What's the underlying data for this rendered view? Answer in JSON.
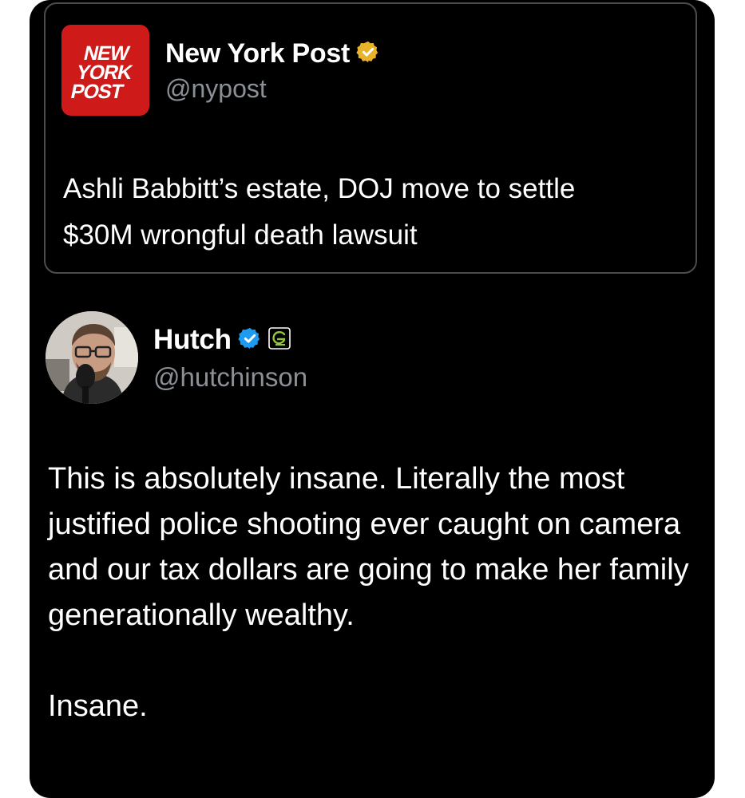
{
  "quoted_post": {
    "author_name": "New York Post",
    "handle": "@nypost",
    "logo": {
      "lines": [
        "NEW",
        "YORK",
        "POST"
      ],
      "icon": "nypost-logo",
      "color": "#cf1a1a"
    },
    "badge": {
      "icon": "gold-verified-badge-icon",
      "color": "#e8b22b"
    },
    "text": "Ashli Babbitt’s estate, DOJ move to settle\n$30M wrongful death lawsuit"
  },
  "post": {
    "author_name": "Hutch",
    "handle": "@hutchinson",
    "avatar": {
      "icon": "profile-photo-avatar"
    },
    "badge": {
      "icon": "blue-verified-badge-icon",
      "color": "#1d9bf0"
    },
    "affiliate_icon": "optic-gaming-affiliate-icon",
    "paragraphs": [
      "This is absolutely insane. Literally the most justified police shooting ever caught on camera and our tax dollars are going to make her family generationally wealthy.",
      "Insane."
    ]
  },
  "colors": {
    "background": "#000000",
    "text": "#ffffff",
    "secondary_text": "#8b9096",
    "card_border": "#4a4d50"
  }
}
